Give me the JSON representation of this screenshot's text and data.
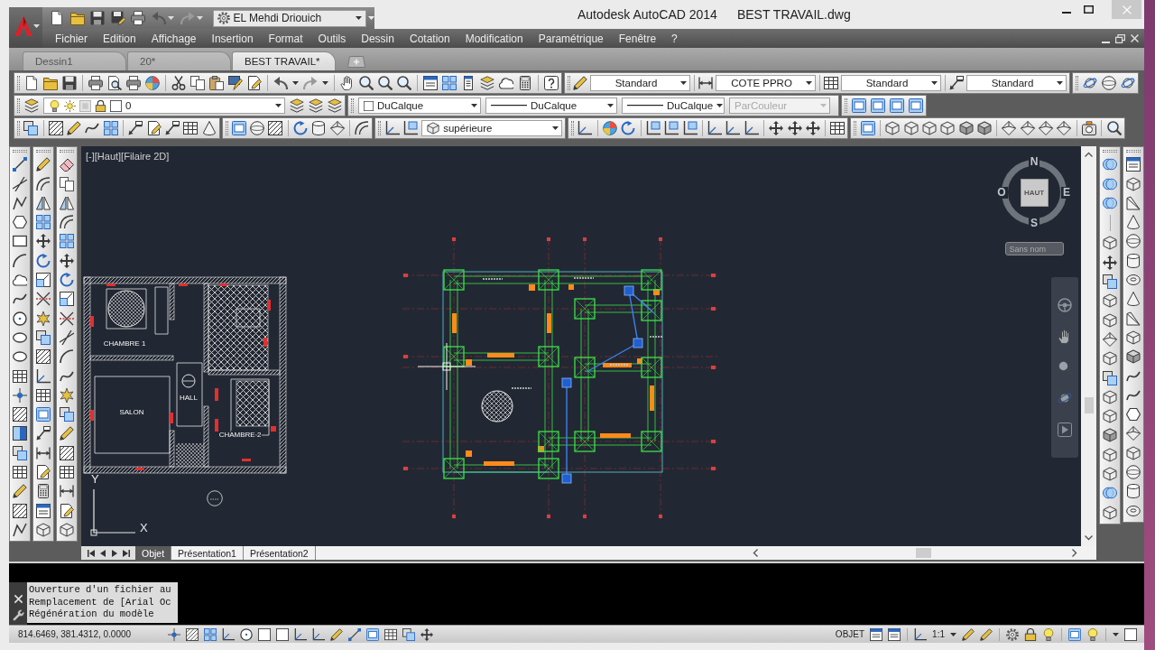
{
  "window": {
    "title": "Autodesk AutoCAD 2014",
    "document": "BEST TRAVAIL.dwg"
  },
  "quick_access": {
    "workspace": "EL Mehdi Driouich"
  },
  "menu": [
    "Fichier",
    "Edition",
    "Affichage",
    "Insertion",
    "Format",
    "Outils",
    "Dessin",
    "Cotation",
    "Modification",
    "Paramétrique",
    "Fenêtre",
    "?"
  ],
  "file_tabs": [
    {
      "label": "Dessin1",
      "selected": false
    },
    {
      "label": "20*",
      "selected": false
    },
    {
      "label": "BEST TRAVAIL*",
      "selected": true
    }
  ],
  "styles": {
    "text_style": "Standard",
    "dimension_style": "COTE PPRO",
    "table_style": "Standard",
    "multileader_style": "Standard"
  },
  "layer": {
    "current": "0"
  },
  "properties": {
    "object_color": "DuCalque",
    "linetype": "DuCalque",
    "lineweight": "DuCalque",
    "plot_style": {
      "value": "ParCouleur",
      "disabled": true
    }
  },
  "view": {
    "preset": "supérieure"
  },
  "viewport": {
    "label": "[-][Haut][Filaire 2D]",
    "room_labels": [
      "CHAMBRE 1",
      "HALL",
      "SALON",
      "CHAMBRE 2"
    ],
    "ucs_axes": {
      "y": "Y",
      "x": "X"
    },
    "viewcube": {
      "north": "N",
      "west": "O",
      "face": "HAUT",
      "east": "E",
      "south": "S",
      "ucs": "Sans nom"
    }
  },
  "layout_tabs": [
    {
      "label": "Objet",
      "selected": true
    },
    {
      "label": "Présentation1",
      "selected": false
    },
    {
      "label": "Présentation2",
      "selected": false
    }
  ],
  "command_history": [
    "Ouverture d'un fichier au",
    "Remplacement de [Arial Oc",
    "Régénération du modèle"
  ],
  "status_bar": {
    "coordinates": "814.6469, 381.4312, 0.0000",
    "space": "OBJET",
    "annotation_scale": "1:1"
  }
}
